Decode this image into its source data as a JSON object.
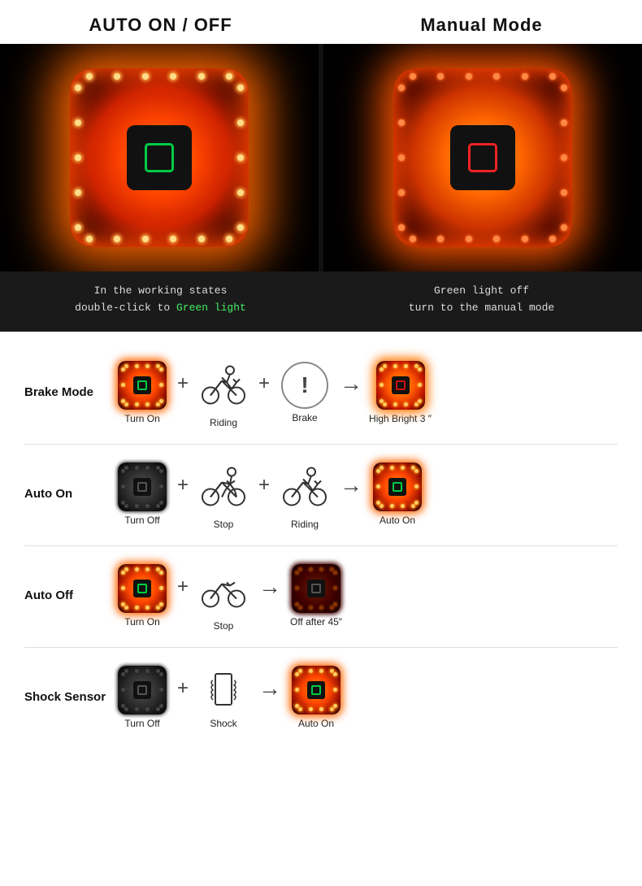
{
  "header": {
    "left_title": "AUTO ON / OFF",
    "right_title": "Manual Mode"
  },
  "captions": {
    "left_line1": "In the working states",
    "left_line2": "double-click to ",
    "left_green": "Green light",
    "right_line1": "Green light off",
    "right_line2": "turn to the manual mode"
  },
  "modes": [
    {
      "label": "Brake Mode",
      "steps": [
        {
          "type": "led-bright-green",
          "text": "Turn On"
        },
        {
          "type": "plus"
        },
        {
          "type": "bike-riding",
          "text": "Riding"
        },
        {
          "type": "plus"
        },
        {
          "type": "brake",
          "text": "Brake"
        },
        {
          "type": "arrow"
        },
        {
          "type": "led-result-red",
          "text": "High Bright 3 ″"
        }
      ]
    },
    {
      "label": "Auto On",
      "steps": [
        {
          "type": "led-dark-dim",
          "text": "Turn Off"
        },
        {
          "type": "plus"
        },
        {
          "type": "bike-stop",
          "text": "Stop"
        },
        {
          "type": "plus"
        },
        {
          "type": "bike-riding2",
          "text": "Riding"
        },
        {
          "type": "arrow"
        },
        {
          "type": "led-result-green",
          "text": "Auto On"
        }
      ]
    },
    {
      "label": "Auto Off",
      "steps": [
        {
          "type": "led-bright-green",
          "text": "Turn On"
        },
        {
          "type": "plus"
        },
        {
          "type": "bike-stop2",
          "text": "Stop"
        },
        {
          "type": "arrow"
        },
        {
          "type": "led-result-dark-dim",
          "text": "Off after 45″"
        }
      ]
    },
    {
      "label": "Shock Sensor",
      "steps": [
        {
          "type": "led-dark-dim2",
          "text": "Turn Off"
        },
        {
          "type": "plus"
        },
        {
          "type": "shock",
          "text": "Shock"
        },
        {
          "type": "arrow"
        },
        {
          "type": "led-result-bright2",
          "text": "Auto On"
        }
      ]
    }
  ]
}
